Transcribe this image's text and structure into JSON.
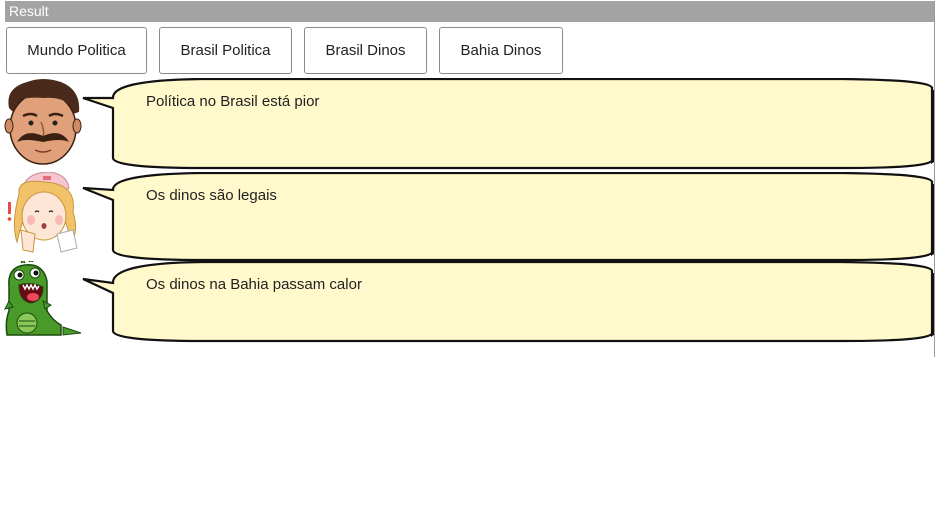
{
  "header": {
    "title": "Result"
  },
  "buttons": {
    "mundo_politica": "Mundo Politica",
    "brasil_politica": "Brasil Politica",
    "brasil_dinos": "Brasil Dinos",
    "bahia_dinos": "Bahia Dinos"
  },
  "conversation": [
    {
      "avatar": "mustache-man-icon",
      "text": "Política no Brasil está pior"
    },
    {
      "avatar": "nurse-girl-icon",
      "text": "Os dinos são legais"
    },
    {
      "avatar": "green-dinosaur-icon",
      "text": "Os dinos na Bahia passam calor"
    }
  ],
  "colors": {
    "bubble_fill": "#fff9cc",
    "result_bar": "#a3a3a3",
    "dino_green": "#4a9a2a"
  }
}
